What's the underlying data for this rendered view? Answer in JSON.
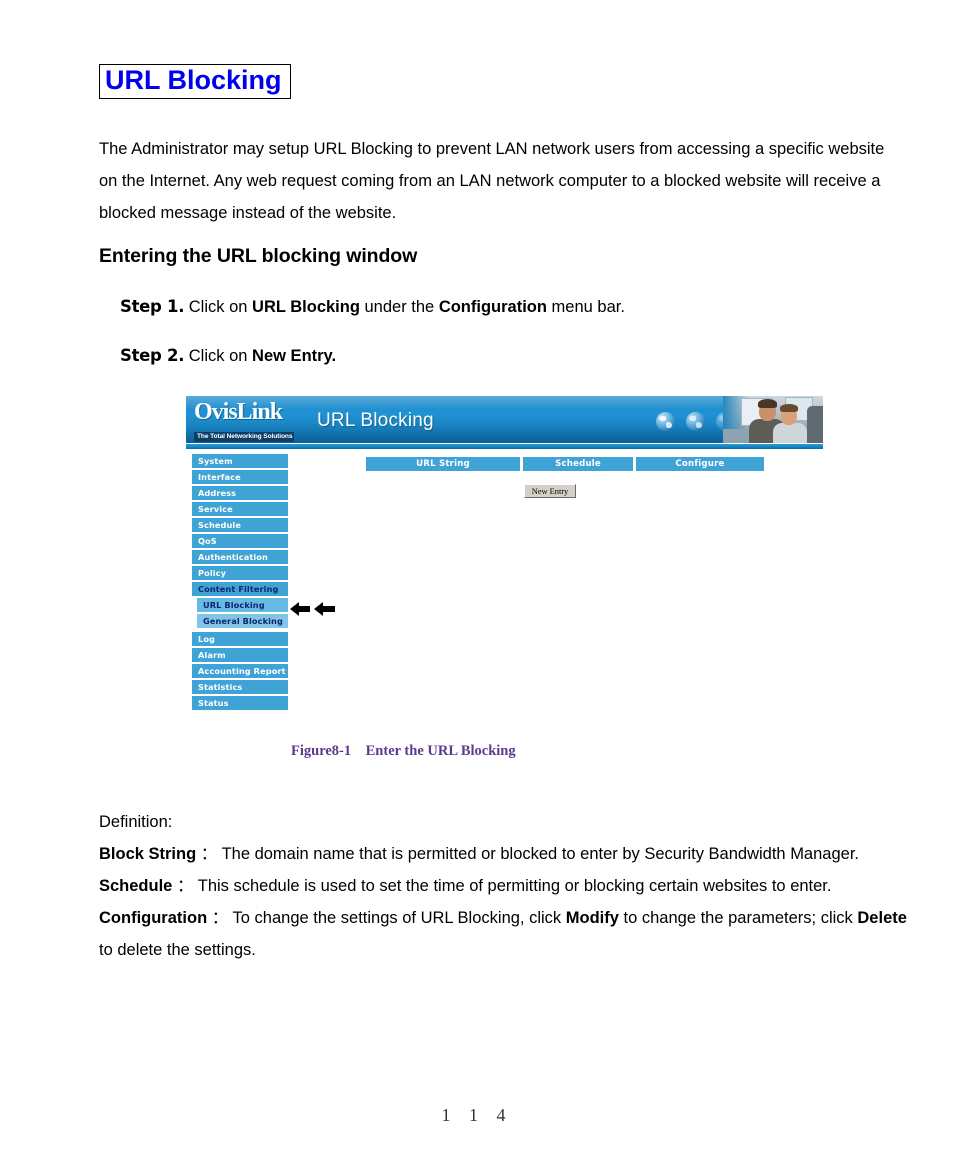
{
  "document": {
    "title": "URL Blocking",
    "title_color": "#0000ee",
    "intro": "The Administrator may setup URL Blocking to prevent LAN network users from accessing a specific website on the Internet.    Any web request coming from an LAN network computer to a blocked website will receive a blocked message instead of the website.",
    "section_heading": "Entering the URL blocking window",
    "page_number": "1 1 4"
  },
  "steps": [
    {
      "label": "Step 1.",
      "parts": [
        {
          "text": "Click on ",
          "bold": false
        },
        {
          "text": "URL Blocking",
          "bold": true
        },
        {
          "text": " under the ",
          "bold": false
        },
        {
          "text": "Configuration",
          "bold": true
        },
        {
          "text": " menu bar.",
          "bold": false
        }
      ]
    },
    {
      "label": "Step 2.",
      "parts": [
        {
          "text": "Click on ",
          "bold": false
        },
        {
          "text": "New Entry.",
          "bold": true
        }
      ]
    }
  ],
  "screenshot": {
    "brand": {
      "logo": "OvisLink",
      "tagline": "The Total Networking Solutions"
    },
    "header_title": "URL Blocking",
    "header_color": "#1a84c2",
    "icons": {
      "globe": "globe-icon",
      "photo": "people-at-computer-photo"
    },
    "sidebar": {
      "items": [
        {
          "label": "System",
          "level": "top",
          "state": "normal"
        },
        {
          "label": "Interface",
          "level": "top",
          "state": "normal"
        },
        {
          "label": "Address",
          "level": "top",
          "state": "normal"
        },
        {
          "label": "Service",
          "level": "top",
          "state": "normal"
        },
        {
          "label": "Schedule",
          "level": "top",
          "state": "normal"
        },
        {
          "label": "QoS",
          "level": "top",
          "state": "normal"
        },
        {
          "label": "Authentication",
          "level": "top",
          "state": "normal"
        },
        {
          "label": "Policy",
          "level": "top",
          "state": "normal"
        },
        {
          "label": "Content Filtering",
          "level": "top",
          "state": "selected"
        },
        {
          "label": "URL Blocking",
          "level": "sub",
          "state": "active"
        },
        {
          "label": "General Blocking",
          "level": "sub",
          "state": "normal"
        },
        {
          "label": "Log",
          "level": "top",
          "state": "normal"
        },
        {
          "label": "Alarm",
          "level": "top",
          "state": "normal"
        },
        {
          "label": "Accounting Report",
          "level": "top",
          "state": "normal"
        },
        {
          "label": "Statistics",
          "level": "top",
          "state": "normal"
        },
        {
          "label": "Status",
          "level": "top",
          "state": "normal"
        }
      ],
      "sidebar_color": "#3fa3d6",
      "sub_color": "#7fc6e8",
      "selected_text_color": "#10246e"
    },
    "table": {
      "columns": [
        "URL String",
        "Schedule",
        "Configure"
      ],
      "rows": []
    },
    "new_entry_button": "New Entry",
    "annotation": "double-left-arrow pointing at URL Blocking"
  },
  "caption": "Figure8-1    Enter the URL Blocking",
  "caption_color": "#5b3a8e",
  "definitions": {
    "heading": "Definition:",
    "entries": [
      {
        "term": "Block String",
        "separator": "：",
        "parts": [
          {
            "text": "The domain name that is permitted or blocked to enter by Security Bandwidth Manager.",
            "bold": false
          }
        ]
      },
      {
        "term": "Schedule",
        "separator": "：",
        "parts": [
          {
            "text": "This schedule is used to set the time of permitting or blocking certain websites to enter.",
            "bold": false
          }
        ]
      },
      {
        "term": "Configuration",
        "separator": "：",
        "parts": [
          {
            "text": "To change the settings of URL Blocking, click ",
            "bold": false
          },
          {
            "text": "Modify",
            "bold": true
          },
          {
            "text": " to change the parameters; click ",
            "bold": false
          },
          {
            "text": "Delete",
            "bold": true
          },
          {
            "text": " to delete the settings.",
            "bold": false
          }
        ]
      }
    ]
  }
}
